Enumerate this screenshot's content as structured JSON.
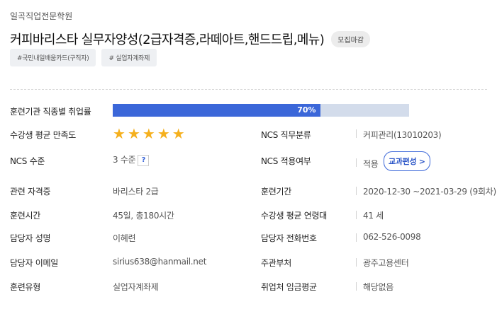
{
  "header": {
    "institution": "일곡직업전문학원",
    "course_title": "커피바리스타 실무자양성(2급자격증,라떼아트,핸드드립,메뉴)",
    "status_badge": "모집마감",
    "tags": [
      "#국민내일배움카드(구직자)",
      "# 실업자계좌제"
    ]
  },
  "details": {
    "employment_rate": {
      "label": "훈련기관 직종별 취업률",
      "value_text": "70%",
      "percent": 70
    },
    "satisfaction": {
      "label": "수강생 평균 만족도",
      "stars": 5
    },
    "ncs_category": {
      "label": "NCS 직무분류",
      "value": "커피관리(13010203)"
    },
    "ncs_level": {
      "label": "NCS 수준",
      "value": "3 수준",
      "help": "?"
    },
    "ncs_applied": {
      "label": "NCS 적용여부",
      "value": "적용",
      "button": "교과편성 >"
    },
    "certificate": {
      "label": "관련 자격증",
      "value": "바리스타 2급"
    },
    "period": {
      "label": "훈련기간",
      "value": "2020-12-30 ~2021-03-29 (9회차)"
    },
    "hours": {
      "label": "훈련시간",
      "value": "45일, 총180시간"
    },
    "avg_age": {
      "label": "수강생 평균 연령대",
      "value": "41 세"
    },
    "manager_name": {
      "label": "담당자 성명",
      "value": "이혜련"
    },
    "manager_phone": {
      "label": "담당자 전화번호",
      "value": "062-526-0098"
    },
    "manager_email": {
      "label": "담당자 이메일",
      "value": "sirius638@hanmail.net"
    },
    "department": {
      "label": "주관부처",
      "value": "광주고용센터"
    },
    "training_type": {
      "label": "훈련유형",
      "value": "실업자계좌제"
    },
    "avg_wage": {
      "label": "취업처 임금평균",
      "value": "해당없음"
    }
  },
  "colors": {
    "accent": "#3b67d9",
    "bar_track": "#d3dceb",
    "star": "#f5b01d"
  }
}
